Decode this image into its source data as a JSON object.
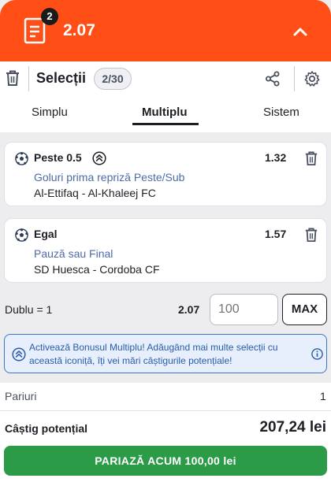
{
  "header": {
    "selections_badge": "2",
    "total_odds": "2.07",
    "collapse_icon": "chevron-up-icon",
    "accent_color": "#ff4e16"
  },
  "selections": {
    "title": "Selecții",
    "count": "2/30",
    "icons": [
      "trash-icon",
      "share-icon",
      "gear-icon"
    ]
  },
  "tabs": [
    {
      "label": "Simplu",
      "active": false
    },
    {
      "label": "Multiplu",
      "active": true
    },
    {
      "label": "Sistem",
      "active": false
    }
  ],
  "bets": [
    {
      "pick": "Peste 0.5",
      "odd": "1.32",
      "market": "Goluri prima repriză Peste/Sub",
      "event": "Al-Ettifaq - Al-Khaleej FC",
      "boosted": true
    },
    {
      "pick": "Egal",
      "odd": "1.57",
      "market": "Pauză sau Final",
      "event": "SD Huesca - Cordoba CF",
      "boosted": false
    }
  ],
  "stake": {
    "label": "Dublu = 1",
    "odds": "2.07",
    "placeholder": "100",
    "max_label": "MAX"
  },
  "bonus": {
    "text": "Activează Bonusul Multiplu! Adăugând mai multe selecții cu această iconiță, îți vei mări câștigurile potențiale!",
    "color": "#3d76c7"
  },
  "summary": {
    "bets_label": "Pariuri",
    "bets_value": "1",
    "win_label": "Câștig potențial",
    "win_value": "207,24 lei"
  },
  "place_bet": {
    "label": "PARIAZĂ ACUM 100,00 lei",
    "color": "#2c9b48"
  }
}
